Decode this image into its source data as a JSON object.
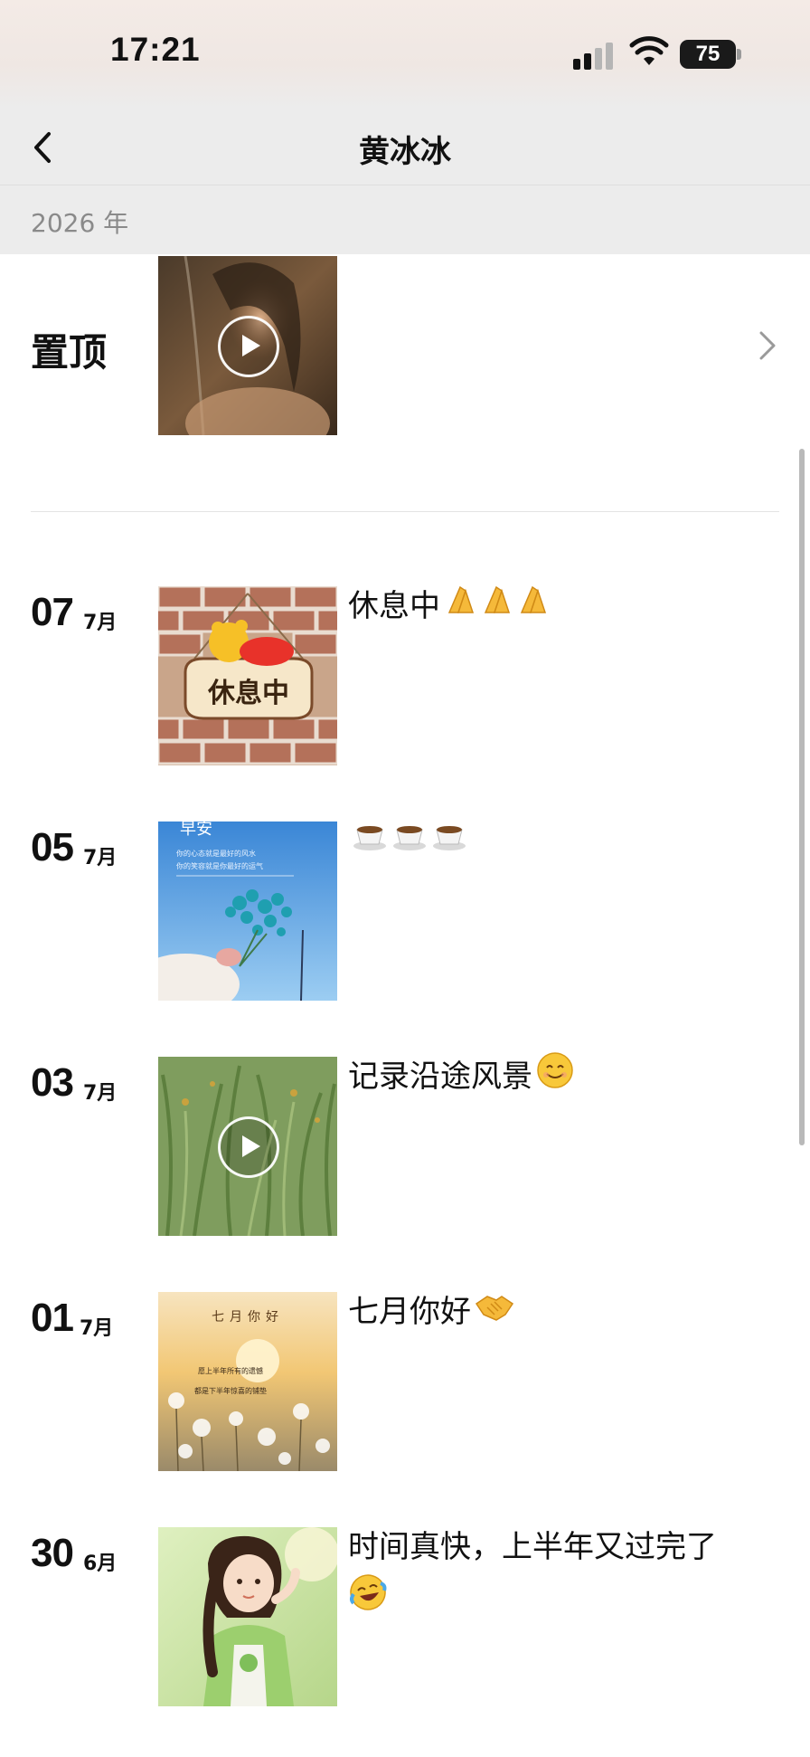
{
  "status_bar": {
    "time": "17:21",
    "battery": "75"
  },
  "nav": {
    "title": "黄冰冰"
  },
  "year": "2026 年",
  "pinned": {
    "label": "置顶"
  },
  "posts": [
    {
      "day": "07",
      "month": "7月",
      "text": "休息中"
    },
    {
      "day": "05",
      "month": "7月",
      "text": ""
    },
    {
      "day": "03",
      "month": "7月",
      "text": "记录沿途风景"
    },
    {
      "day": "01",
      "month": "7月",
      "text": "七月你好"
    },
    {
      "day": "30",
      "month": "6月",
      "text": "时间真快，上半年又过完了"
    }
  ],
  "thumb_texts": {
    "rest_sign": "休息中",
    "morning_title": "早安",
    "morning_line1": "你的心态就是最好的风水",
    "morning_line2": "你的笑容就是你最好的运气",
    "july_title": "七月你好",
    "july_line1": "愿上半年所有的遗憾",
    "july_line2": "都是下半年惊喜的铺垫"
  },
  "icons": [
    "back-icon",
    "chevron-right-icon",
    "play-icon",
    "signal-icon",
    "wifi-icon",
    "battery-icon",
    "pray-emoji",
    "coffee-emoji",
    "smile-emoji",
    "handshake-emoji",
    "laugh-cry-emoji"
  ]
}
